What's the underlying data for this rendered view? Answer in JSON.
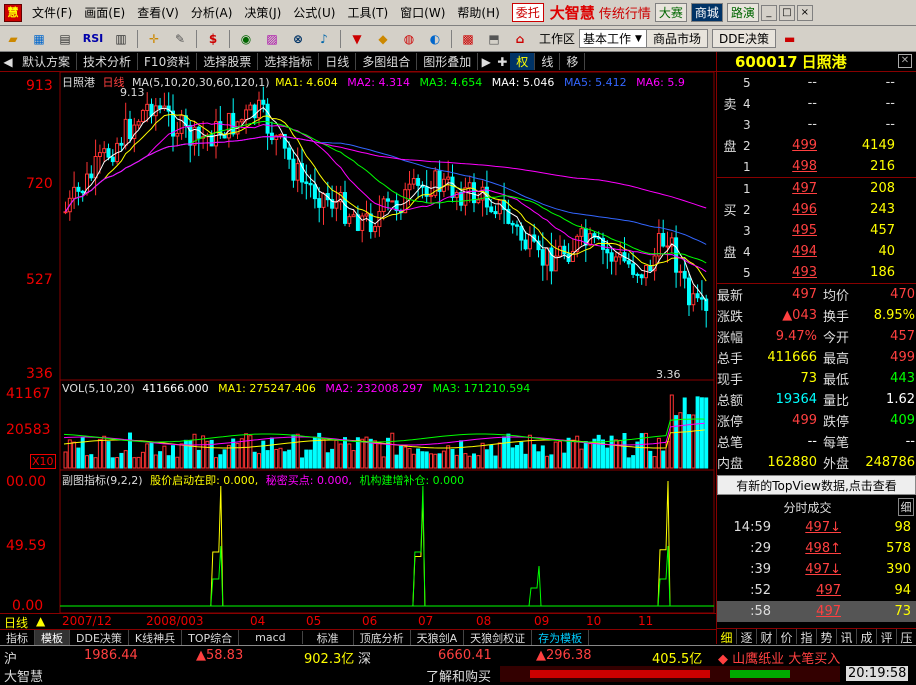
{
  "menubar": {
    "items": [
      "文件(F)",
      "画面(E)",
      "查看(V)",
      "分析(A)",
      "决策(J)",
      "公式(U)",
      "工具(T)",
      "窗口(W)",
      "帮助(H)"
    ],
    "entrust": "委托",
    "brand": "大智慧",
    "brand_sub": "传统行情",
    "btn_contest": "大赛",
    "btn_mall": "商城",
    "btn_road": "路演"
  },
  "toolbar": {
    "workarea_label": "工作区",
    "workarea_value": "基本工作",
    "btn_market": "商品市场",
    "btn_dde": "DDE决策"
  },
  "subbar": {
    "items": [
      "默认方案",
      "技术分析",
      "F10资料",
      "选择股票",
      "选择指标",
      "日线",
      "多图组合",
      "图形叠加"
    ],
    "icons": [
      "权",
      "线",
      "移"
    ]
  },
  "chart": {
    "stock_name": "日照港",
    "period": "日线",
    "ma_legend": "MA(5,10,20,30,60,120,1)",
    "ma_values": [
      {
        "label": "MA1: 4.604",
        "color": "#ffffff"
      },
      {
        "label": "MA2: 4.314",
        "color": "#ffff00"
      },
      {
        "label": "MA3: 4.654",
        "color": "#ff00ff"
      },
      {
        "label": "MA4: 5.046",
        "color": "#00ff00"
      },
      {
        "label": "MA5: 5.412",
        "color": "#3366ff"
      },
      {
        "label": "MA6: 5.9",
        "color": "#ff00ff"
      }
    ],
    "price_axis": [
      "913",
      "720",
      "527",
      "336"
    ],
    "high_label": "9.13",
    "low_label": "3.36",
    "vol_legend": "VOL(5,10,20)",
    "vol_values": [
      "411666.000",
      "MA1: 275247.406",
      "MA2: 232008.297",
      "MA3: 171210.594"
    ],
    "vol_axis": [
      "41167",
      "20583",
      "X10"
    ],
    "ind_legend": "副图指标(9,2,2)",
    "ind_values": [
      "股价启动在即: 0.000,",
      "秘密买点: 0.000,",
      "机构建增补仓: 0.000"
    ],
    "ind_axis": [
      "00.00",
      "49.59",
      "0.00"
    ],
    "dates": [
      "2007/12",
      "2008/003",
      "04",
      "05",
      "06",
      "07",
      "08",
      "09",
      "10",
      "11"
    ],
    "daily_label": "日线"
  },
  "bottom_tabs": [
    "指标",
    "模板",
    "DDE决策",
    "K线神兵",
    "TOP综合",
    "macd",
    "标准",
    "顶底分析",
    "天狼剑A",
    "天狼剑权证",
    "存为模板"
  ],
  "quote": {
    "code": "600017",
    "name": "日照港",
    "sell": [
      {
        "lvl": "5",
        "price": "--",
        "vol": "--"
      },
      {
        "lvl": "4",
        "price": "--",
        "vol": "--"
      },
      {
        "lvl": "3",
        "price": "--",
        "vol": "--"
      },
      {
        "lvl": "2",
        "price": "499",
        "vol": "4149"
      },
      {
        "lvl": "1",
        "price": "498",
        "vol": "216"
      }
    ],
    "buy": [
      {
        "lvl": "1",
        "price": "497",
        "vol": "208"
      },
      {
        "lvl": "2",
        "price": "496",
        "vol": "243"
      },
      {
        "lvl": "3",
        "price": "495",
        "vol": "457"
      },
      {
        "lvl": "4",
        "price": "494",
        "vol": "40"
      },
      {
        "lvl": "5",
        "price": "493",
        "vol": "186"
      }
    ],
    "sell_label": [
      "卖",
      "盘"
    ],
    "buy_label": [
      "买",
      "盘"
    ],
    "stats": [
      {
        "k1": "最新",
        "v1": "497",
        "c1": "#ff4040",
        "k2": "均价",
        "v2": "470",
        "c2": "#ff4040"
      },
      {
        "k1": "涨跌",
        "v1": "▲043",
        "c1": "#ff4040",
        "k2": "换手",
        "v2": "8.95%",
        "c2": "#ffff00"
      },
      {
        "k1": "涨幅",
        "v1": "9.47%",
        "c1": "#ff4040",
        "k2": "今开",
        "v2": "457",
        "c2": "#ff4040"
      },
      {
        "k1": "总手",
        "v1": "411666",
        "c1": "#ffff00",
        "k2": "最高",
        "v2": "499",
        "c2": "#ff4040"
      },
      {
        "k1": "现手",
        "v1": "73",
        "c1": "#ffff00",
        "k2": "最低",
        "v2": "443",
        "c2": "#00ff00"
      },
      {
        "k1": "总额",
        "v1": "19364",
        "c1": "#00ffff",
        "k2": "量比",
        "v2": "1.62",
        "c2": "#ffffff"
      },
      {
        "k1": "涨停",
        "v1": "499",
        "c1": "#ff4040",
        "k2": "跌停",
        "v2": "409",
        "c2": "#00ff00"
      },
      {
        "k1": "总笔",
        "v1": "--",
        "c1": "#ffffff",
        "k2": "每笔",
        "v2": "--",
        "c2": "#ffffff"
      },
      {
        "k1": "内盘",
        "v1": "162880",
        "c1": "#ffff00",
        "k2": "外盘",
        "v2": "248786",
        "c2": "#ffff00"
      }
    ],
    "topview": "有新的TopView数据,点击查看",
    "ticks_title": "分时成交",
    "ticks_btn": "细",
    "ticks": [
      {
        "time": "14:59",
        "price": "497↓",
        "pc": "#ff4040",
        "vol": "98"
      },
      {
        "time": ":29",
        "price": "498↑",
        "pc": "#ff4040",
        "vol": "578"
      },
      {
        "time": ":39",
        "price": "497↓",
        "pc": "#ff4040",
        "vol": "390"
      },
      {
        "time": ":52",
        "price": "497",
        "pc": "#ff4040",
        "vol": "94"
      },
      {
        "time": ":58",
        "price": "497",
        "pc": "#ff4040",
        "vol": "73"
      }
    ],
    "rtabs": [
      "细",
      "逐",
      "财",
      "价",
      "指",
      "势",
      "讯",
      "成",
      "评",
      "压"
    ]
  },
  "status": {
    "sh_label": "沪",
    "sh_index": "1986.44",
    "sh_change": "▲58.83",
    "sh_amount": "902.3亿",
    "sz_label": "深",
    "sz_index": "6660.41",
    "sz_change": "▲296.38",
    "sz_amount": "405.5亿",
    "alert": "◆ 山鹰纸业 大笔买入",
    "brand": "大智慧",
    "ticker": "了解和购买",
    "time": "20:19:58"
  }
}
